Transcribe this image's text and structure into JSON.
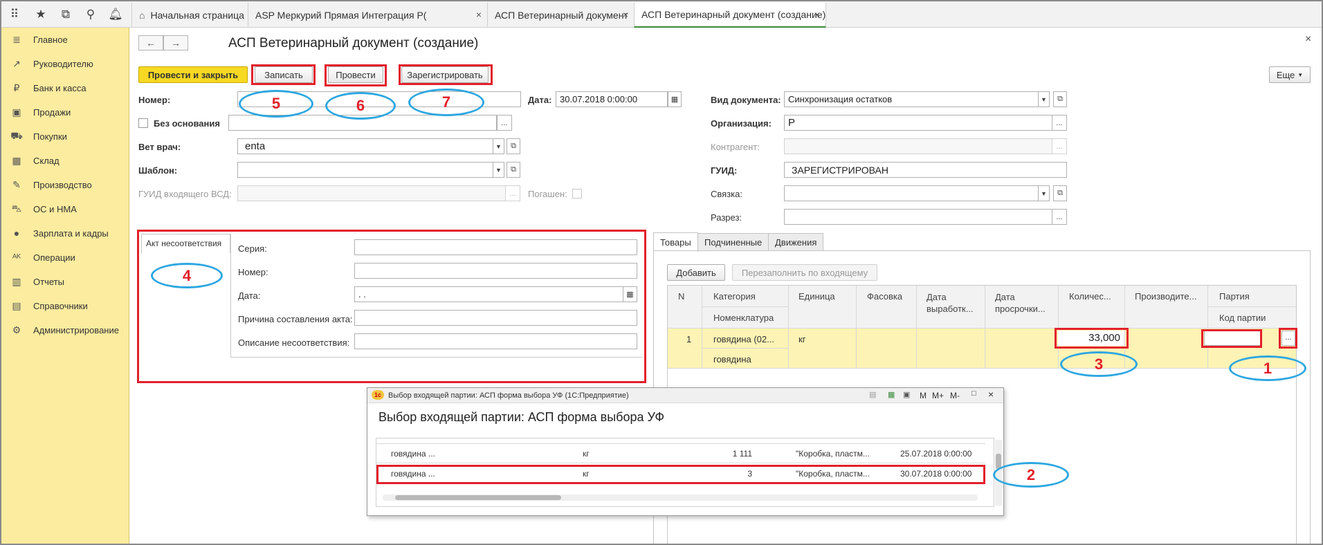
{
  "topbar": {
    "icons": [
      "apps-grid-icon",
      "star-icon",
      "history-icon",
      "search-icon",
      "bell-icon"
    ],
    "tabs": [
      {
        "label": "Начальная страница",
        "active": false,
        "closable": false
      },
      {
        "label": "ASP Меркурий Прямая Интеграция Р(",
        "active": false,
        "closable": true
      },
      {
        "label": "АСП Ветеринарный документ",
        "active": false,
        "closable": true
      },
      {
        "label": "АСП Ветеринарный документ (создание)",
        "active": true,
        "closable": true
      }
    ]
  },
  "sidebar": {
    "items": [
      {
        "label": "Главное",
        "icon": "menu-lines-icon"
      },
      {
        "label": "Руководителю",
        "icon": "trend-icon"
      },
      {
        "label": "Банк и касса",
        "icon": "ruble-icon"
      },
      {
        "label": "Продажи",
        "icon": "bag-icon"
      },
      {
        "label": "Покупки",
        "icon": "cart-icon"
      },
      {
        "label": "Склад",
        "icon": "grid-icon"
      },
      {
        "label": "Производство",
        "icon": "wrench-icon"
      },
      {
        "label": "ОС и НМА",
        "icon": "truck-icon"
      },
      {
        "label": "Зарплата и кадры",
        "icon": "person-icon"
      },
      {
        "label": "Операции",
        "icon": "operations-icon"
      },
      {
        "label": "Отчеты",
        "icon": "chart-icon"
      },
      {
        "label": "Справочники",
        "icon": "book-icon"
      },
      {
        "label": "Администрирование",
        "icon": "gear-icon"
      }
    ]
  },
  "form": {
    "title": "АСП Ветеринарный документ (создание)",
    "nav_back": "←",
    "nav_forward": "→",
    "close": "×",
    "toolbar": {
      "post_close": "Провести и закрыть",
      "save": "Записать",
      "post": "Провести",
      "register": "Зарегистрировать",
      "more": "Еще"
    },
    "fields": {
      "number_label": "Номер:",
      "number_value": "",
      "date_label": "Дата:",
      "date_value": "30.07.2018  0:00:00",
      "no_basis_label": "Без основания",
      "no_basis_value": "",
      "vet_label": "Вет врач:",
      "vet_value": "enta",
      "template_label": "Шаблон:",
      "template_value": "",
      "guid_in_label": "ГУИД входящего ВСД:",
      "guid_in_value": "",
      "paid_label": "Погашен:",
      "doc_type_label": "Вид документа:",
      "doc_type_value": "Синхронизация остатков",
      "org_label": "Организация:",
      "org_value": "Р",
      "counterparty_label": "Контрагент:",
      "counterparty_value": "",
      "guid_label": "ГУИД:",
      "guid_value": "ЗАРЕГИСТРИРОВАН",
      "link_label": "Связка:",
      "link_value": "",
      "section_label": "Разрез:",
      "section_value": ""
    },
    "nonconformity": {
      "tab": "Акт несоответствия",
      "series_label": "Серия:",
      "number_label": "Номер:",
      "date_label": "Дата:",
      "date_value": " .  .",
      "reason_label": "Причина составления акта:",
      "description_label": "Описание несоответствия:"
    },
    "goods": {
      "tabs": [
        "Товары",
        "Подчиненные",
        "Движения"
      ],
      "add": "Добавить",
      "refill": "Перезаполнить по входящему",
      "headers": {
        "n": "N",
        "category": "Категория",
        "nomenclature": "Номенклатура",
        "unit": "Единица",
        "packing": "Фасовка",
        "prod_date": "Дата выработк...",
        "exp_date": "Дата просрочки...",
        "qty": "Количес...",
        "producer": "Производите...",
        "batch": "Партия",
        "batch_code": "Код партии"
      },
      "rows": [
        {
          "n": "1",
          "category": "говядина (02...",
          "nomenclature": "говядина",
          "unit": "кг",
          "qty": "33,000",
          "batch": ""
        }
      ]
    }
  },
  "dialog": {
    "window_title": "Выбор входящей партии: АСП форма выбора УФ  (1С:Предприятие)",
    "heading": "Выбор входящей партии: АСП форма выбора УФ",
    "toolbar_buttons": [
      "M",
      "M+",
      "M-"
    ],
    "rows": [
      {
        "name": "говядина ...",
        "unit": "кг",
        "qty": "1 111",
        "pack": "\"Коробка, пластм...",
        "date": "25.07.2018 0:00:00"
      },
      {
        "name": "говядина ...",
        "unit": "кг",
        "qty": "3",
        "pack": "\"Коробка, пластм...",
        "date": "30.07.2018 0:00:00"
      }
    ]
  },
  "annotations": {
    "labels": [
      "1",
      "2",
      "3",
      "4",
      "5",
      "6",
      "7"
    ],
    "box_color": "#e2202b",
    "ellipse_color": "#2ea7e0"
  }
}
